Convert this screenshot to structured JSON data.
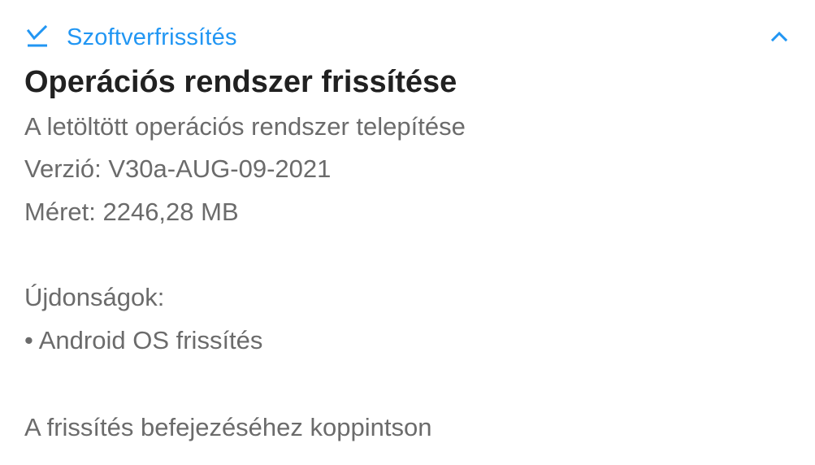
{
  "notification": {
    "app_name": "Szoftverfrissítés",
    "app_icon": "download-check-icon",
    "expand_icon": "chevron-up-icon",
    "accent_color": "#2196f3",
    "title": "Operációs rendszer frissítése",
    "lines": [
      "A letöltött operációs rendszer telepítése",
      "Verzió: V30a-AUG-09-2021",
      "Méret: 2246,28 MB",
      "Újdonságok:",
      "• Android OS frissítés",
      "A frissítés befejezéséhez koppintson"
    ]
  }
}
